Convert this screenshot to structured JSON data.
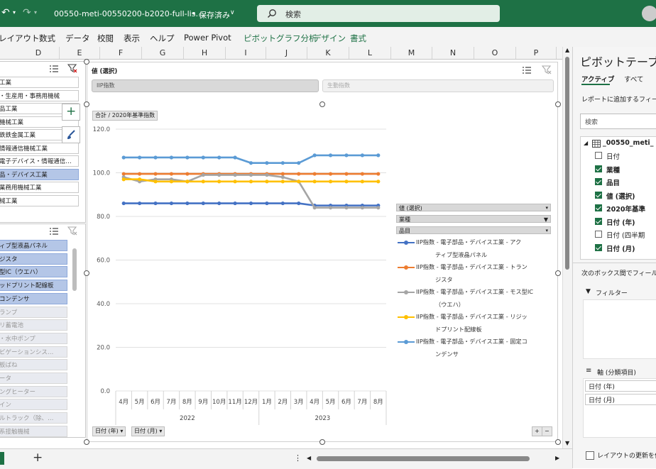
{
  "titlebar": {
    "filename": "00550-meti-00550200-b2020-full-lis…",
    "save_status": "保存済み",
    "search_placeholder": "検索"
  },
  "ribbon": {
    "tabs": [
      "レイアウト",
      "数式",
      "データ",
      "校閲",
      "表示",
      "ヘルプ",
      "Power Pivot"
    ],
    "context_tabs": [
      "ピボットグラフ分析",
      "デザイン",
      "書式"
    ]
  },
  "columns": [
    "D",
    "E",
    "F",
    "G",
    "H",
    "I",
    "J",
    "K",
    "L",
    "M",
    "N",
    "O",
    "P"
  ],
  "slicer_industry": {
    "items": [
      {
        "label": "工業",
        "state": "normal"
      },
      {
        "label": "・生産用・事務用機械",
        "state": "normal"
      },
      {
        "label": "品工業",
        "state": "normal"
      },
      {
        "label": "機械工業",
        "state": "normal"
      },
      {
        "label": "鉄鉄金属工業",
        "state": "normal"
      },
      {
        "label": "情報通信機械工業",
        "state": "normal"
      },
      {
        "label": "電子デバイス・情報通信…",
        "state": "normal"
      },
      {
        "label": "品・デバイス工業",
        "state": "selected"
      },
      {
        "label": "業務用機械工業",
        "state": "normal"
      },
      {
        "label": "械工業",
        "state": "normal"
      }
    ]
  },
  "slicer_item": {
    "items": [
      {
        "label": "ィブ型液晶パネル",
        "state": "selected"
      },
      {
        "label": "ジスタ",
        "state": "selected"
      },
      {
        "label": "型IC（ウエハ）",
        "state": "selected"
      },
      {
        "label": "ッドプリント配線板",
        "state": "selected"
      },
      {
        "label": "コンデンサ",
        "state": "selected"
      },
      {
        "label": "ランプ",
        "state": "dim"
      },
      {
        "label": "リ蓄電池",
        "state": "dim"
      },
      {
        "label": "・水中ポンプ",
        "state": "dim"
      },
      {
        "label": "ビゲーションシス…",
        "state": "dim"
      },
      {
        "label": "板ばね",
        "state": "dim"
      },
      {
        "label": "ータ",
        "state": "dim"
      },
      {
        "label": "ングヒーター",
        "state": "dim"
      },
      {
        "label": "イン",
        "state": "dim"
      },
      {
        "label": "ルトラック（除、…",
        "state": "dim"
      },
      {
        "label": "系接触機械",
        "state": "dim"
      }
    ]
  },
  "chart": {
    "values_header": "値 (選択)",
    "value_button_1": "IIP指数",
    "value_button_2": "生動指数",
    "measure_button": "合計 / 2020年基準指数",
    "axis_button_1": "日付 (年)",
    "axis_button_2": "日付 (月)",
    "legend_header": "値 (選択)",
    "legend_filter_1": "業種",
    "legend_filter_2": "品目"
  },
  "chart_data": {
    "type": "line",
    "ylim": [
      0,
      120
    ],
    "yticks": [
      "0.0",
      "20.0",
      "40.0",
      "60.0",
      "80.0",
      "100.0",
      "120.0"
    ],
    "categories": [
      "4月",
      "5月",
      "6月",
      "7月",
      "8月",
      "9月",
      "10月",
      "11月",
      "12月",
      "1月",
      "2月",
      "3月",
      "4月",
      "5月",
      "6月",
      "7月",
      "8月"
    ],
    "year_groups": [
      {
        "label": "2022",
        "count": 9
      },
      {
        "label": "2023",
        "count": 8
      }
    ],
    "series": [
      {
        "name": "IIP指数 - 電子部品・デバイス工業 - アクティブ型液晶パネル",
        "color": "#4472c4",
        "values": [
          86,
          86,
          86,
          86,
          86,
          86,
          86,
          86,
          86,
          86,
          86,
          86,
          85,
          85,
          85,
          85,
          85
        ]
      },
      {
        "name": "IIP指数 - 電子部品・デバイス工業 - トランジスタ",
        "color": "#ed7d31",
        "values": [
          99.5,
          99.5,
          99.5,
          99.5,
          99.5,
          99.5,
          99.5,
          99.5,
          99.5,
          99.5,
          99.5,
          99.5,
          99.5,
          99.5,
          99.5,
          99.5,
          99.5
        ]
      },
      {
        "name": "IIP指数 - 電子部品・デバイス工業 - モス型IC（ウエハ）",
        "color": "#a5a5a5",
        "values": [
          98,
          96,
          97,
          97,
          96,
          99,
          99,
          99,
          99,
          99,
          98,
          96,
          84,
          84,
          84,
          84,
          84
        ]
      },
      {
        "name": "IIP指数 - 電子部品・デバイス工業 - リジッドプリント配線板",
        "color": "#ffc000",
        "values": [
          97,
          97,
          96,
          96,
          96,
          96,
          96,
          96,
          96,
          96,
          96,
          96,
          96,
          96,
          96,
          96,
          96
        ]
      },
      {
        "name": "IIP指数 - 電子部品・デバイス工業 - 固定コンデンサ",
        "color": "#5b9bd5",
        "values": [
          107,
          107,
          107,
          107,
          107,
          107,
          107,
          107,
          104.5,
          104.5,
          104.5,
          104.5,
          108,
          108,
          108,
          108,
          108
        ]
      }
    ]
  },
  "legend_display": [
    [
      "IIP指数 - 電子部品・デバイス工業 - アク",
      "ティブ型液晶パネル"
    ],
    [
      "IIP指数 - 電子部品・デバイス工業 - トラン",
      "ジスタ"
    ],
    [
      "IIP指数 - 電子部品・デバイス工業 - モス型IC",
      "（ウエハ）"
    ],
    [
      "IIP指数 - 電子部品・デバイス工業 - リジッ",
      "ドプリント配線板"
    ],
    [
      "IIP指数 - 電子部品・デバイス工業 - 固定コ",
      "ンデンサ"
    ]
  ],
  "pane": {
    "title": "ピボットテーブル",
    "tab_active": "アクティブ",
    "tab_all": "すべて",
    "hint": "レポートに追加するフィール",
    "search_placeholder": "検索",
    "table_name": "_00550_meti_",
    "fields": [
      {
        "label": "日付",
        "checked": false,
        "bold": false
      },
      {
        "label": "業種",
        "checked": true,
        "bold": true
      },
      {
        "label": "品目",
        "checked": true,
        "bold": true
      },
      {
        "label": "値 (選択)",
        "checked": true,
        "bold": true
      },
      {
        "label": "2020年基準",
        "checked": true,
        "bold": true
      },
      {
        "label": "日付 (年)",
        "checked": true,
        "bold": true
      },
      {
        "label": "日付 (四半期",
        "checked": false,
        "bold": false
      },
      {
        "label": "日付 (月)",
        "checked": true,
        "bold": true
      }
    ],
    "drag_hint": "次のボックス間でフィールドを",
    "filter_label": "フィルター",
    "axis_label": "軸 (分類項目)",
    "axis_items": [
      "日付 (年)",
      "日付 (月)"
    ],
    "defer_label": "レイアウトの更新を保"
  },
  "colors": {
    "brand": "#1e7145",
    "selected": "#b4c6e7"
  }
}
